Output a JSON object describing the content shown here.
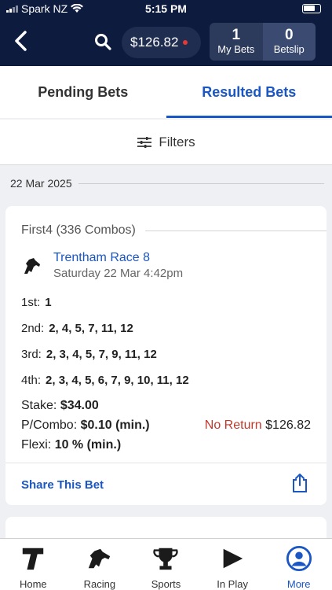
{
  "status_bar": {
    "carrier": "Spark NZ",
    "time": "5:15 PM"
  },
  "header": {
    "balance": "$126.82",
    "my_bets_count": "1",
    "my_bets_label": "My Bets",
    "betslip_count": "0",
    "betslip_label": "Betslip"
  },
  "tabs": [
    {
      "label": "Pending Bets",
      "active": false
    },
    {
      "label": "Resulted Bets",
      "active": true
    }
  ],
  "filters_label": "Filters",
  "date": "22 Mar 2025",
  "bet": {
    "title": "First4 (336 Combos)",
    "race_name": "Trentham Race 8",
    "race_time": "Saturday 22 Mar 4:42pm",
    "positions": [
      {
        "label": "1st:",
        "value": "1"
      },
      {
        "label": "2nd:",
        "value": "2, 4, 5, 7, 11, 12"
      },
      {
        "label": "3rd:",
        "value": "2, 3, 4, 5, 7, 9, 11, 12"
      },
      {
        "label": "4th:",
        "value": "2, 3, 4, 5, 6, 7, 9, 10, 11, 12"
      }
    ],
    "stake_label": "Stake:",
    "stake_value": "$34.00",
    "pcombo_label": "P/Combo:",
    "pcombo_value": "$0.10 (min.)",
    "flexi_label": "Flexi:",
    "flexi_value": "10 % (min.)",
    "return_status": "No Return",
    "return_amount": "$126.82",
    "share_label": "Share This Bet"
  },
  "next_bet_peek": "",
  "bottom_nav": [
    {
      "label": "Home",
      "icon": "home-t-icon"
    },
    {
      "label": "Racing",
      "icon": "horse-icon"
    },
    {
      "label": "Sports",
      "icon": "trophy-icon"
    },
    {
      "label": "In Play",
      "icon": "play-icon"
    },
    {
      "label": "More",
      "icon": "user-icon",
      "active": true
    }
  ],
  "colors": {
    "navy": "#0d1b3e",
    "accent": "#1a56c4",
    "no_return": "#c0392b"
  }
}
